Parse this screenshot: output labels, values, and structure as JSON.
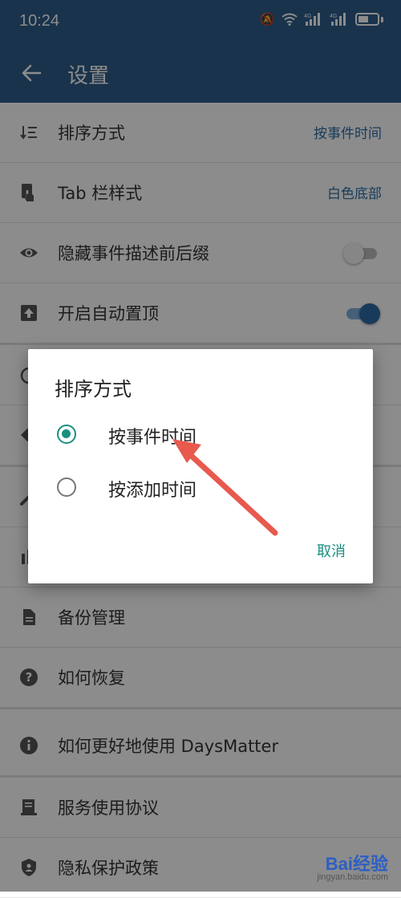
{
  "status_bar": {
    "time": "10:24",
    "icons": [
      "mute-icon",
      "wifi-icon",
      "signal-4g-icon",
      "signal-4g-icon-2",
      "battery-icon"
    ]
  },
  "app_bar": {
    "title": "设置"
  },
  "settings": [
    {
      "label": "排序方式",
      "value": "按事件时间",
      "icon": "sort-icon"
    },
    {
      "label": "Tab 栏样式",
      "value": "白色底部",
      "icon": "touch-icon"
    },
    {
      "label": "隐藏事件描述前后缀",
      "toggle": "off",
      "icon": "eye-icon"
    },
    {
      "label": "开启自动置顶",
      "toggle": "on",
      "icon": "pin-top-icon"
    },
    {
      "label": "",
      "icon": "alarm-icon"
    },
    {
      "label": "",
      "icon": "tag-icon"
    },
    {
      "label": "",
      "icon": "wrench-icon"
    },
    {
      "label": "",
      "icon": "bar-icon"
    },
    {
      "label": "备份管理",
      "icon": "file-icon"
    },
    {
      "label": "如何恢复",
      "icon": "help-icon"
    },
    {
      "label": "如何更好地使用 DaysMatter",
      "icon": "info-icon"
    },
    {
      "label": "服务使用协议",
      "icon": "agreement-icon"
    },
    {
      "label": "隐私保护政策",
      "icon": "shield-icon"
    }
  ],
  "dialog": {
    "title": "排序方式",
    "options": [
      {
        "label": "按事件时间",
        "checked": true
      },
      {
        "label": "按添加时间",
        "checked": false
      }
    ],
    "cancel": "取消"
  },
  "watermark": {
    "brand": "Bai经验",
    "url": "jingyan.baidu.com"
  },
  "colors": {
    "app_bar": "#2e5e8a",
    "accent_value": "#2d6ea6",
    "dialog_accent": "#1a8f80",
    "arrow": "#e8594e"
  }
}
